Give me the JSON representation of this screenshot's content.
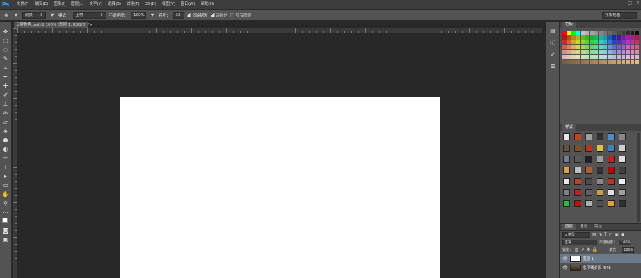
{
  "app": {
    "logo": "Ps"
  },
  "menu": [
    "文件(F)",
    "编辑(E)",
    "图像(I)",
    "图层(L)",
    "文字(Y)",
    "选择(S)",
    "滤镜(T)",
    "3D(D)",
    "视图(V)",
    "窗口(W)",
    "帮助(H)"
  ],
  "window_controls": {
    "minimize": "–",
    "maximize": "□",
    "close": "✕"
  },
  "options": {
    "tool_preset": "前景",
    "mode_label": "模式：",
    "mode_value": "正常",
    "opacity_label": "不透明度：",
    "opacity_value": "100%",
    "tolerance_label": "容差：",
    "tolerance_value": "32",
    "antialias_label": "消除锯齿",
    "antialias_checked": true,
    "contiguous_label": "连续的",
    "contiguous_checked": true,
    "all_layers_label": "所有图层",
    "all_layers_checked": false,
    "workspace": "排版视图"
  },
  "document": {
    "tab_title": "云雾教程.psd @ 100% (图层 1, RGB/8) *",
    "close": "×"
  },
  "panels": {
    "swatches_tab": "色板",
    "styles_tab": "样式",
    "layers_tabs": [
      "图层",
      "通道",
      "路径"
    ],
    "filter_label": "ρ 类型",
    "blend_mode": "正常",
    "opacity_label": "不透明度：",
    "opacity_value": "100%",
    "lock_label": "锁定：",
    "fill_label": "填充：",
    "fill_value": "100%",
    "layers": [
      {
        "name": "图层 1",
        "selected": true
      },
      {
        "name": "水平线夕阳_548",
        "selected": false
      }
    ]
  }
}
